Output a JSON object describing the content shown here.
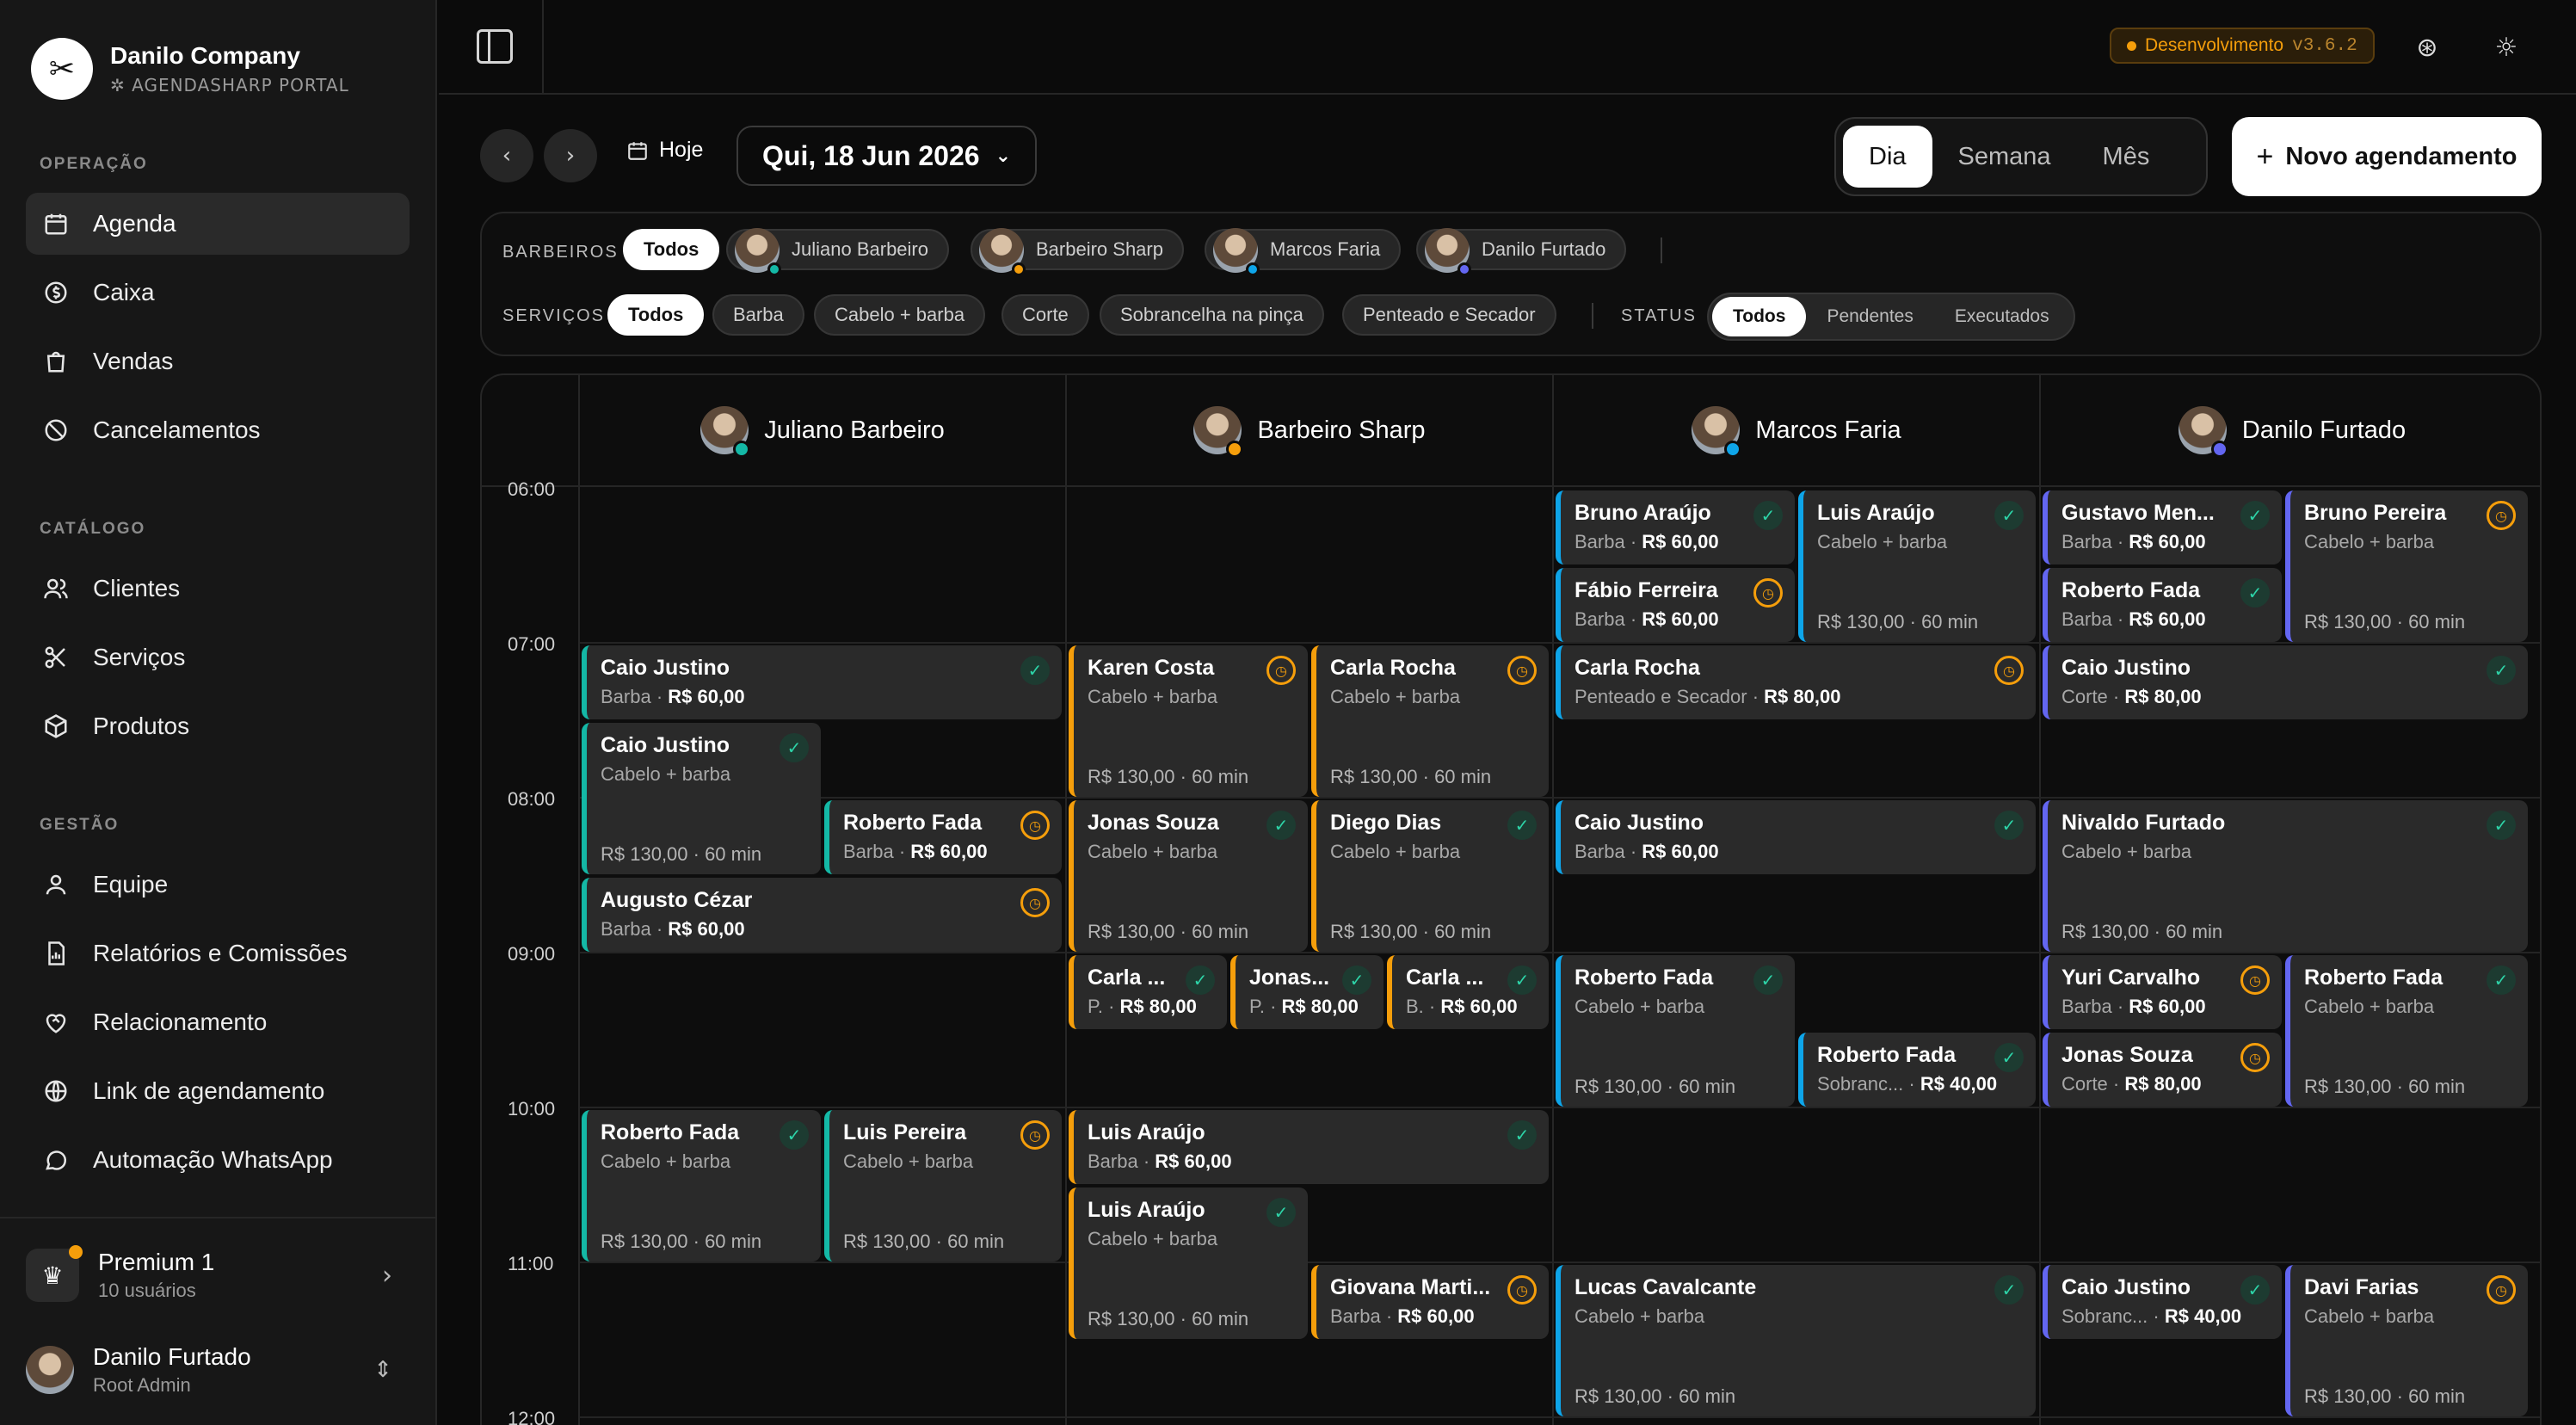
{
  "company": {
    "name": "Danilo Company",
    "subtitle": "AGENDASHARP PORTAL"
  },
  "nav": {
    "sections": [
      {
        "label": "OPERAÇÃO"
      },
      {
        "label": "CATÁLOGO"
      },
      {
        "label": "GESTÃO"
      }
    ],
    "items": [
      {
        "label": "Agenda",
        "icon": "calendar-icon",
        "active": true
      },
      {
        "label": "Caixa",
        "icon": "dollar-icon"
      },
      {
        "label": "Vendas",
        "icon": "shopping-bag-icon"
      },
      {
        "label": "Cancelamentos",
        "icon": "ban-icon"
      },
      {
        "label": "Clientes",
        "icon": "users-icon"
      },
      {
        "label": "Serviços",
        "icon": "scissors-icon"
      },
      {
        "label": "Produtos",
        "icon": "package-icon"
      },
      {
        "label": "Equipe",
        "icon": "user-icon"
      },
      {
        "label": "Relatórios e Comissões",
        "icon": "report-icon"
      },
      {
        "label": "Relacionamento",
        "icon": "heart-handshake-icon"
      },
      {
        "label": "Link de agendamento",
        "icon": "globe-icon"
      },
      {
        "label": "Automação WhatsApp",
        "icon": "message-icon"
      }
    ]
  },
  "plan": {
    "name": "Premium 1",
    "users": "10 usuários"
  },
  "user": {
    "name": "Danilo Furtado",
    "role": "Root Admin"
  },
  "topbar": {
    "env": "Desenvolvimento",
    "version": "v3.6.2"
  },
  "toolbar": {
    "today": "Hoje",
    "date": "Qui, 18 Jun 2026",
    "views": [
      "Dia",
      "Semana",
      "Mês"
    ],
    "new_button": "Novo agendamento"
  },
  "filters": {
    "barbers_label": "BARBEIROS",
    "services_label": "SERVIÇOS",
    "status_label": "STATUS",
    "all": "Todos",
    "services": [
      "Barba",
      "Cabelo + barba",
      "Corte",
      "Sobrancelha na pinça",
      "Penteado e Secador"
    ],
    "statuses": [
      "Todos",
      "Pendentes",
      "Executados"
    ]
  },
  "barbers": [
    {
      "name": "Juliano Barbeiro",
      "color": "#14b8a6"
    },
    {
      "name": "Barbeiro Sharp",
      "color": "#f59e0b"
    },
    {
      "name": "Marcos Faria",
      "color": "#0ea5e9"
    },
    {
      "name": "Danilo Furtado",
      "color": "#6366f1"
    }
  ],
  "times": [
    "06:00",
    "07:00",
    "08:00",
    "09:00",
    "10:00",
    "11:00",
    "12:00"
  ],
  "events": [
    {
      "name": "Bruno Araújo",
      "service": "Barba",
      "price": "R$ 60,00",
      "status": "done"
    },
    {
      "name": "Fábio Ferreira",
      "service": "Barba",
      "price": "R$ 60,00",
      "status": "pending"
    },
    {
      "name": "Luis Araújo",
      "service": "Cabelo + barba",
      "foot": "R$ 130,00 · 60 min",
      "status": "done"
    },
    {
      "name": "Gustavo Men...",
      "service": "Barba",
      "price": "R$ 60,00",
      "status": "done"
    },
    {
      "name": "Roberto Fada",
      "service": "Barba",
      "price": "R$ 60,00",
      "status": "done"
    },
    {
      "name": "Bruno Pereira",
      "service": "Cabelo + barba",
      "foot": "R$ 130,00 · 60 min",
      "status": "pending"
    },
    {
      "name": "Caio Justino",
      "service": "Barba",
      "price": "R$ 60,00",
      "status": "done"
    },
    {
      "name": "Caio Justino",
      "service": "Cabelo + barba",
      "foot": "R$ 130,00 · 60 min",
      "status": "done"
    },
    {
      "name": "Roberto Fada",
      "service": "Barba",
      "price": "R$ 60,00",
      "status": "pending"
    },
    {
      "name": "Augusto Cézar",
      "service": "Barba",
      "price": "R$ 60,00",
      "status": "pending"
    },
    {
      "name": "Karen Costa",
      "service": "Cabelo + barba",
      "foot": "R$ 130,00 · 60 min",
      "status": "pending"
    },
    {
      "name": "Carla Rocha",
      "service": "Cabelo + barba",
      "foot": "R$ 130,00 · 60 min",
      "status": "pending"
    },
    {
      "name": "Jonas Souza",
      "service": "Cabelo + barba",
      "foot": "R$ 130,00 · 60 min",
      "status": "done"
    },
    {
      "name": "Diego Dias",
      "service": "Cabelo + barba",
      "foot": "R$ 130,00 · 60 min",
      "status": "done"
    },
    {
      "name": "Carla ...",
      "service": "P.",
      "price": "R$ 80,00",
      "status": "done"
    },
    {
      "name": "Jonas...",
      "service": "P.",
      "price": "R$ 80,00",
      "status": "done"
    },
    {
      "name": "Carla ...",
      "service": "B.",
      "price": "R$ 60,00",
      "status": "done"
    },
    {
      "name": "Carla Rocha",
      "service": "Penteado e Secador",
      "price": "R$ 80,00",
      "status": "pending"
    },
    {
      "name": "Caio Justino",
      "service": "Barba",
      "price": "R$ 60,00",
      "status": "done"
    },
    {
      "name": "Roberto Fada",
      "service": "Cabelo + barba",
      "foot": "R$ 130,00 · 60 min",
      "status": "done"
    },
    {
      "name": "Roberto Fada",
      "service": "Sobranc...",
      "price": "R$ 40,00",
      "status": "done"
    },
    {
      "name": "Caio Justino",
      "service": "Corte",
      "price": "R$ 80,00",
      "status": "done"
    },
    {
      "name": "Nivaldo Furtado",
      "service": "Cabelo + barba",
      "foot": "R$ 130,00 · 60 min",
      "status": "done"
    },
    {
      "name": "Yuri Carvalho",
      "service": "Barba",
      "price": "R$ 60,00",
      "status": "pending"
    },
    {
      "name": "Jonas Souza",
      "service": "Corte",
      "price": "R$ 80,00",
      "status": "pending"
    },
    {
      "name": "Roberto Fada",
      "service": "Cabelo + barba",
      "foot": "R$ 130,00 · 60 min",
      "status": "done"
    },
    {
      "name": "Roberto Fada",
      "service": "Cabelo + barba",
      "foot": "R$ 130,00 · 60 min",
      "status": "done"
    },
    {
      "name": "Luis Pereira",
      "service": "Cabelo + barba",
      "foot": "R$ 130,00 · 60 min",
      "status": "pending"
    },
    {
      "name": "Luis Araújo",
      "service": "Barba",
      "price": "R$ 60,00",
      "status": "done"
    },
    {
      "name": "Luis Araújo",
      "service": "Cabelo + barba",
      "foot": "R$ 130,00 · 60 min",
      "status": "done"
    },
    {
      "name": "Giovana Marti...",
      "service": "Barba",
      "price": "R$ 60,00",
      "status": "pending"
    },
    {
      "name": "Lucas Cavalcante",
      "service": "Cabelo + barba",
      "foot": "R$ 130,00 · 60 min",
      "status": "done"
    },
    {
      "name": "Caio Justino",
      "service": "Sobranc...",
      "price": "R$ 40,00",
      "status": "done"
    },
    {
      "name": "Davi Farias",
      "service": "Cabelo + barba",
      "foot": "R$ 130,00 · 60 min",
      "status": "pending"
    }
  ]
}
